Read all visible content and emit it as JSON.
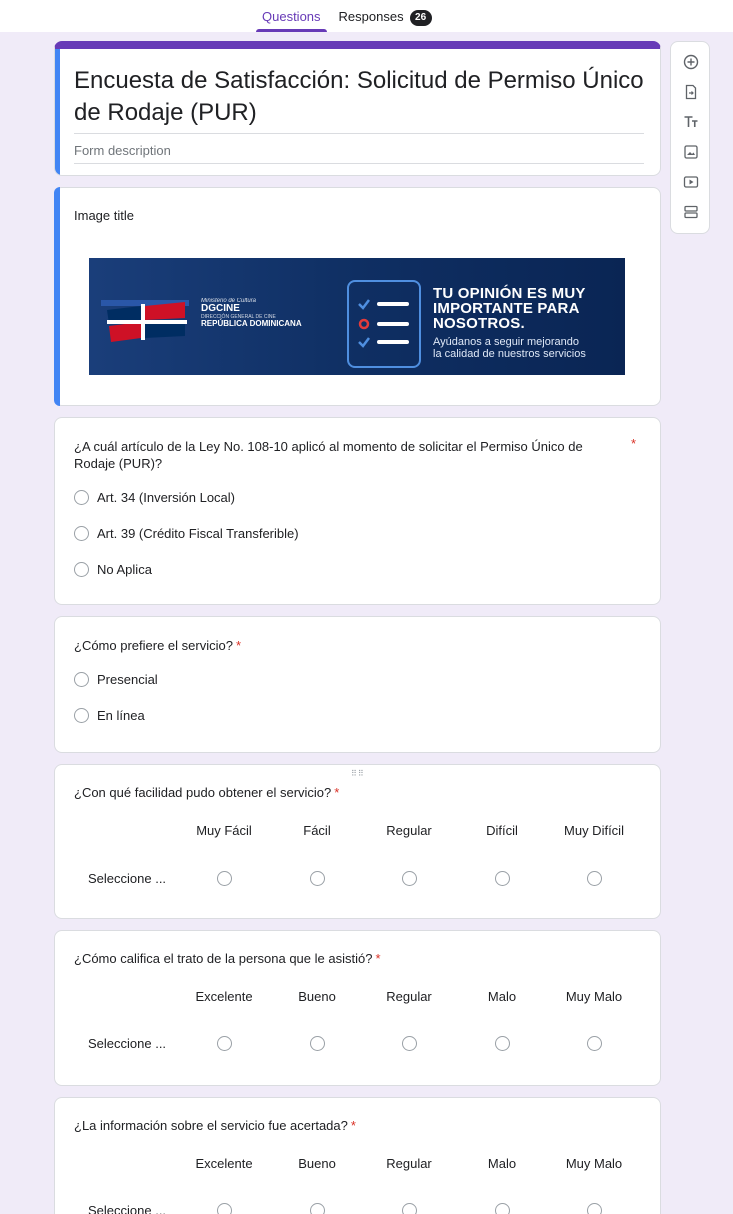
{
  "tabs": {
    "questions": "Questions",
    "responses": "Responses",
    "responses_count": "26"
  },
  "form": {
    "title": "Encuesta de Satisfacción: Solicitud de Permiso Único de Rodaje (PUR)",
    "description_placeholder": "Form description"
  },
  "image_block": {
    "title": "Image title",
    "banner": {
      "ministry": "Ministerio de Cultura",
      "org_name": "DGCINE",
      "org_sub": "DIRECCIÓN GENERAL DE CINE",
      "country": "REPÚBLICA DOMINICANA",
      "headline_1": "TU OPINIÓN ES MUY",
      "headline_2": "IMPORTANTE PARA",
      "headline_3": "NOSOTROS.",
      "sub_1": "Ayúdanos a seguir mejorando",
      "sub_2": "la calidad de nuestros servicios"
    }
  },
  "questions": {
    "q1": {
      "title": "¿A cuál artículo de la Ley No. 108-10 aplicó al momento de solicitar el Permiso Único de Rodaje (PUR)?",
      "required_mark": "*",
      "options": [
        "Art. 34 (Inversión Local)",
        "Art. 39 (Crédito Fiscal Transferible)",
        "No Aplica"
      ]
    },
    "q2": {
      "title": "¿Cómo prefiere el servicio?",
      "required_mark": "*",
      "options": [
        "Presencial",
        "En línea"
      ]
    },
    "q3": {
      "title": "¿Con qué facilidad pudo obtener el servicio?",
      "required_mark": "*",
      "columns": [
        "Muy Fácil",
        "Fácil",
        "Regular",
        "Difícil",
        "Muy Difícil"
      ],
      "row_label": "Seleccione ..."
    },
    "q4": {
      "title": "¿Cómo califica el trato de la persona que le asistió?",
      "required_mark": "*",
      "columns": [
        "Excelente",
        "Bueno",
        "Regular",
        "Malo",
        "Muy Malo"
      ],
      "row_label": "Seleccione ..."
    },
    "q5": {
      "title": "¿La información sobre el servicio fue acertada?",
      "required_mark": "*",
      "columns": [
        "Excelente",
        "Bueno",
        "Regular",
        "Malo",
        "Muy Malo"
      ],
      "row_label": "Seleccione ..."
    }
  },
  "sidebar_icons": [
    "add-question-icon",
    "import-questions-icon",
    "add-title-icon",
    "add-image-icon",
    "add-video-icon",
    "add-section-icon"
  ],
  "colors": {
    "accent": "#673ab7",
    "focus_bar": "#4285f4",
    "background": "#f0ebf8",
    "required": "#d93025"
  }
}
